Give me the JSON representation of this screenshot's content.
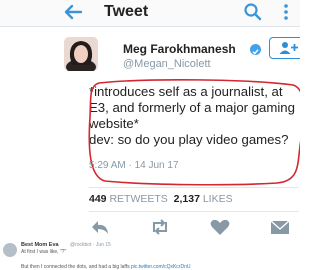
{
  "header": {
    "title": "Tweet"
  },
  "tweet": {
    "name": "Meg Farokhmanesh",
    "handle": "@Megan_Nicolett",
    "text": "*introduces self as a journalist, at\nE3, and formerly of a major gaming\nwebsite*\ndev: so do you play video games?",
    "timestamp": "5:29 AM · 14 Jun 17",
    "retweets_count": "449",
    "retweets_label": "RETWEETS",
    "likes_count": "2,137",
    "likes_label": "LIKES"
  },
  "reply": {
    "name": "Best Mom Eva",
    "handle": "@rockbot · Jun 15",
    "line1": "At first I was like, \"?\"",
    "line2_text": "But then I connected the dots, and had a big laffs",
    "line2_link": "pic.twitter.com/cQxKcrDnU"
  },
  "colors": {
    "accent": "#2e8fd6",
    "annotation": "#d2282f",
    "muted": "#8899a6"
  }
}
